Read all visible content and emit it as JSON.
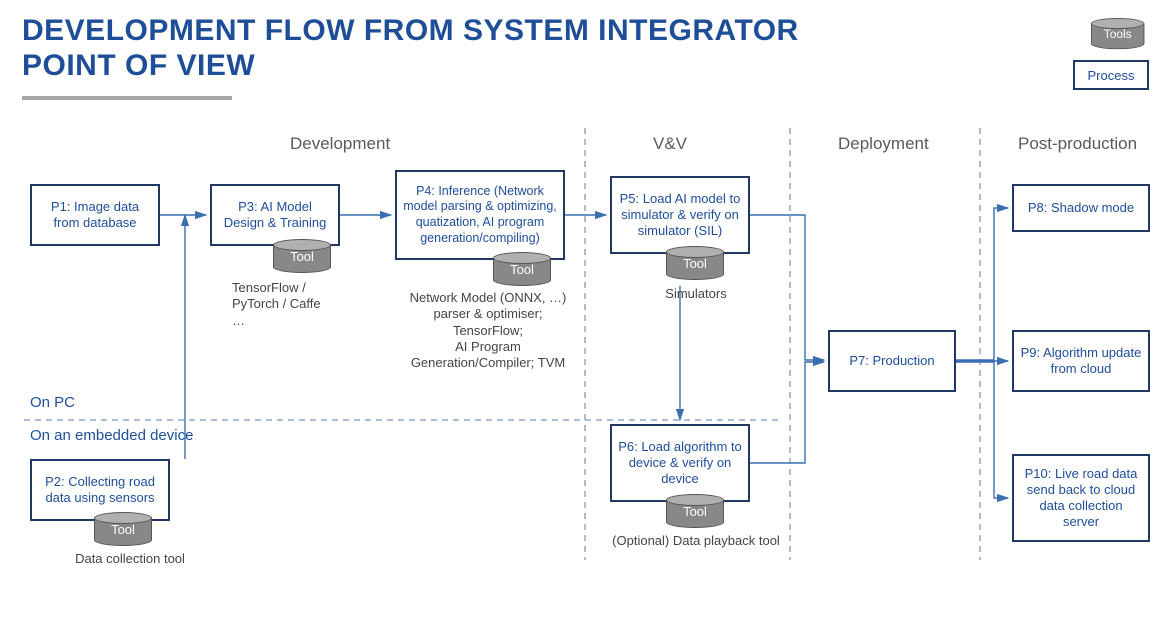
{
  "title_line1": "DEVELOPMENT FLOW FROM SYSTEM INTEGRATOR",
  "title_line2": "POINT OF VIEW",
  "legend": {
    "tool": "Tools",
    "process": "Process"
  },
  "phases": {
    "development": "Development",
    "vv": "V&V",
    "deployment": "Deployment",
    "postprod": "Post-production"
  },
  "sections": {
    "pc": "On PC",
    "embedded": "On an embedded device"
  },
  "boxes": {
    "p1": "P1: Image data from database",
    "p2": "P2: Collecting road data using sensors",
    "p3": "P3: AI Model Design & Training",
    "p4": "P4: Inference (Network model parsing & optimizing, quatization, AI program generation/compiling)",
    "p5": "P5: Load AI model to simulator & verify on simulator (SIL)",
    "p6": "P6: Load algorithm to device & verify on device",
    "p7": "P7: Production",
    "p8": "P8: Shadow mode",
    "p9": "P9: Algorithm update from cloud",
    "p10": "P10: Live road data send back to cloud data collection server"
  },
  "tool_label": "Tool",
  "captions": {
    "p2": "Data collection tool",
    "p3": "TensorFlow / PyTorch / Caffe …",
    "p4": "Network Model (ONNX, …) parser & optimiser; TensorFlow;\nAI Program Generation/Compiler; TVM",
    "p5": "Simulators",
    "p6": "(Optional) Data playback tool"
  }
}
